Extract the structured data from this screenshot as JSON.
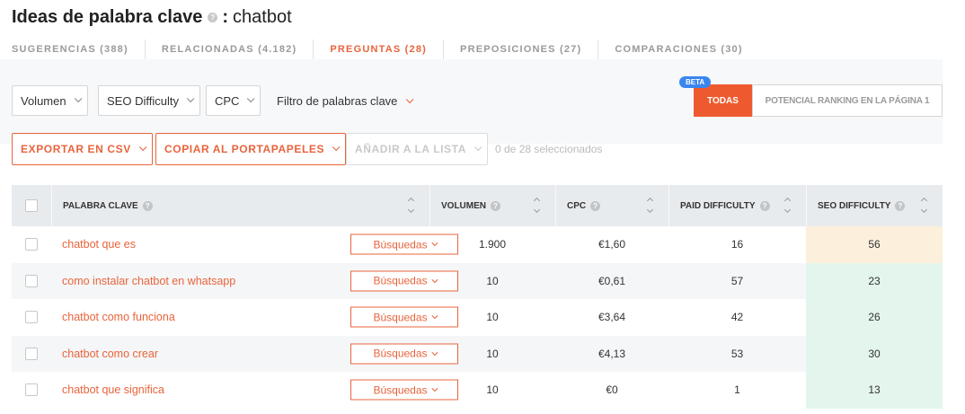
{
  "header": {
    "title_bold": "Ideas de palabra clave",
    "help_glyph": "?",
    "separator": ":",
    "keyword": "chatbot"
  },
  "tabs": [
    {
      "label": "SUGERENCIAS (388)",
      "active": false
    },
    {
      "label": "RELACIONADAS (4.182)",
      "active": false
    },
    {
      "label": "PREGUNTAS (28)",
      "active": true
    },
    {
      "label": "PREPOSICIONES (27)",
      "active": false
    },
    {
      "label": "COMPARACIONES (30)",
      "active": false
    }
  ],
  "filters": {
    "volume": "Volumen",
    "seo_difficulty": "SEO Difficulty",
    "cpc": "CPC",
    "keyword_filter": "Filtro de palabras clave"
  },
  "toggle": {
    "badge": "BETA",
    "all_label": "TODAS",
    "ranking_label": "POTENCIAL RANKING EN LA PÁGINA 1"
  },
  "actions": {
    "export_label": "EXPORTAR EN CSV",
    "copy_label": "COPIAR AL PORTAPAPELES",
    "add_label": "AÑADIR A LA LISTA",
    "selected_text": "0 de 28 seleccionados"
  },
  "table": {
    "columns": {
      "keyword": "PALABRA CLAVE",
      "volume": "VOLUMEN",
      "cpc": "CPC",
      "paid_difficulty": "PAID DIFFICULTY",
      "seo_difficulty": "SEO DIFFICULTY"
    },
    "search_button_label": "Búsquedas",
    "rows": [
      {
        "keyword": "chatbot que es",
        "volume": "1.900",
        "cpc": "€1,60",
        "paid": "16",
        "seo": "56",
        "seo_color": "#fcf0dc"
      },
      {
        "keyword": "como instalar chatbot en whatsapp",
        "volume": "10",
        "cpc": "€0,61",
        "paid": "57",
        "seo": "23",
        "seo_color": "#e3f5ec"
      },
      {
        "keyword": "chatbot como funciona",
        "volume": "10",
        "cpc": "€3,64",
        "paid": "42",
        "seo": "26",
        "seo_color": "#e3f5ec"
      },
      {
        "keyword": "chatbot como crear",
        "volume": "10",
        "cpc": "€4,13",
        "paid": "53",
        "seo": "30",
        "seo_color": "#e3f5ec"
      },
      {
        "keyword": "chatbot que significa",
        "volume": "10",
        "cpc": "€0",
        "paid": "1",
        "seo": "13",
        "seo_color": "#e3f5ec"
      }
    ]
  }
}
